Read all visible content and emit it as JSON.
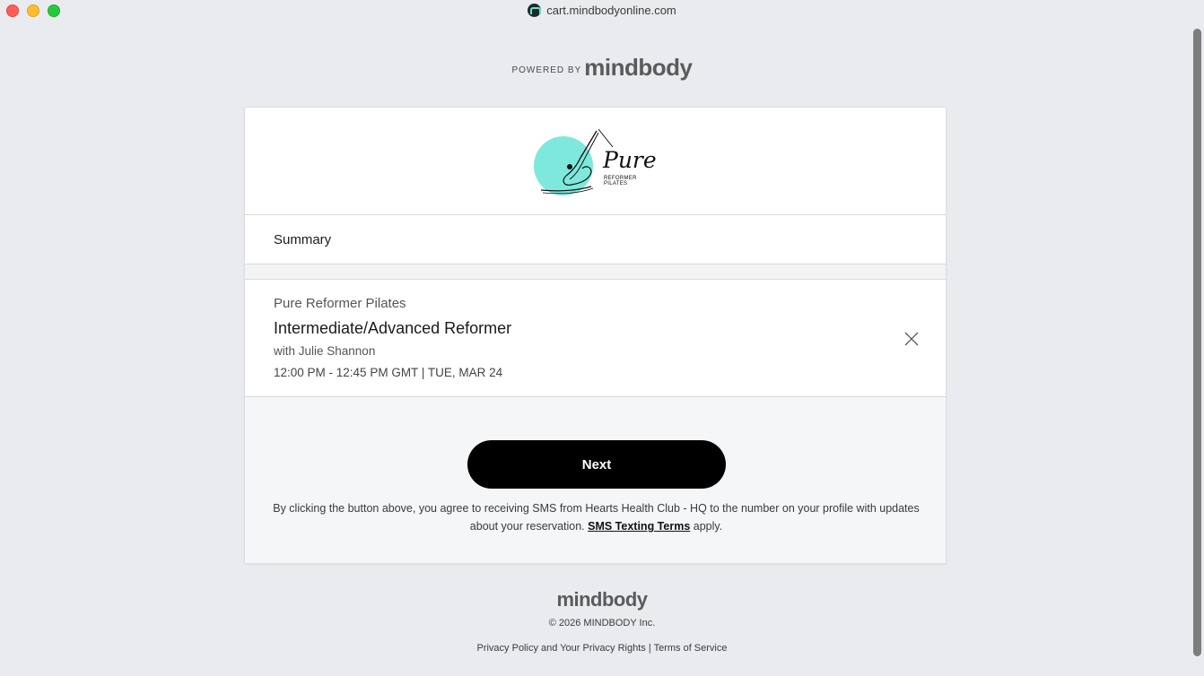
{
  "browser": {
    "url": "cart.mindbodyonline.com"
  },
  "header": {
    "powered_by": "POWERED BY",
    "brand": "mindbody"
  },
  "logo": {
    "word": "Pure",
    "sub": "REFORMER PILATES",
    "accent_color": "#7ee8dc"
  },
  "summary": {
    "title": "Summary"
  },
  "cart_item": {
    "studio": "Pure Reformer Pilates",
    "class_name": "Intermediate/Advanced Reformer",
    "instructor": "with Julie Shannon",
    "time": "12:00 PM - 12:45 PM GMT | TUE, MAR 24",
    "remove_icon": "close-icon"
  },
  "actions": {
    "next_label": "Next",
    "consent_before": "By clicking the button above, you agree to receiving SMS from Hearts Health Club - HQ to the number on your profile with updates about your reservation. ",
    "consent_link": "SMS Texting Terms",
    "consent_after": " apply."
  },
  "footer": {
    "brand": "mindbody",
    "copyright": "© 2026 MINDBODY Inc.",
    "privacy_link": "Privacy Policy and Your Privacy Rights",
    "separator": "|",
    "terms_link": "Terms of Service"
  }
}
